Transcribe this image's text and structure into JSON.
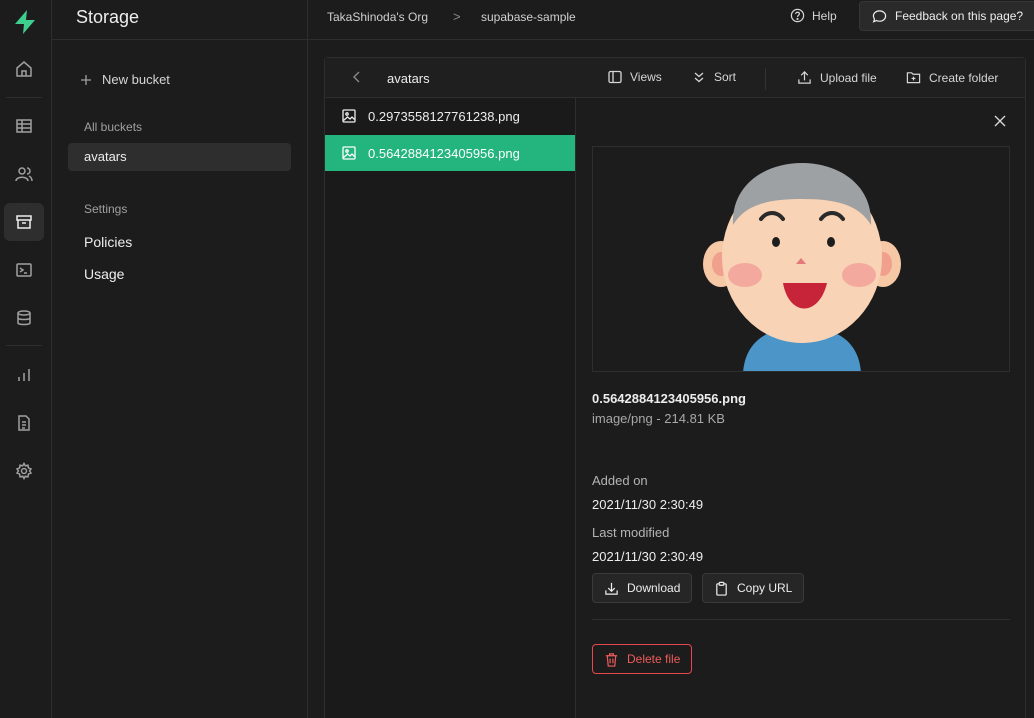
{
  "header": {
    "org": "TakaShinoda's Org",
    "separator": ">",
    "project": "supabase-sample",
    "help_label": "Help",
    "feedback_label": "Feedback on this page?"
  },
  "rail": {
    "icons": [
      "supabase-logo-icon",
      "home-icon",
      "table-icon",
      "users-icon",
      "storage-icon",
      "terminal-icon",
      "database-icon",
      "reports-icon",
      "docs-icon",
      "settings-icon"
    ],
    "active": "storage-icon",
    "accent_color": "#3ecf8e"
  },
  "menu": {
    "title": "Storage",
    "new_bucket_label": "New bucket",
    "all_buckets_label": "All buckets",
    "buckets": [
      {
        "name": "avatars",
        "selected": true
      }
    ],
    "settings_label": "Settings",
    "settings_links": [
      "Policies",
      "Usage"
    ]
  },
  "explorer": {
    "bucket_name": "avatars",
    "views_label": "Views",
    "sort_label": "Sort",
    "upload_label": "Upload file",
    "create_folder_label": "Create folder",
    "files": [
      {
        "name": "0.2973558127761238.png",
        "selected": false
      },
      {
        "name": "0.5642884123405956.png",
        "selected": true
      }
    ],
    "selected_color": "#24b47e"
  },
  "preview": {
    "file_name": "0.5642884123405956.png",
    "file_meta": "image/png - 214.81 KB",
    "added_on_label": "Added on",
    "added_on": "2021/11/30 2:30:49",
    "last_modified_label": "Last modified",
    "last_modified": "2021/11/30 2:30:49",
    "download_label": "Download",
    "copy_url_label": "Copy URL",
    "delete_label": "Delete file",
    "delete_color": "#e5484d"
  }
}
